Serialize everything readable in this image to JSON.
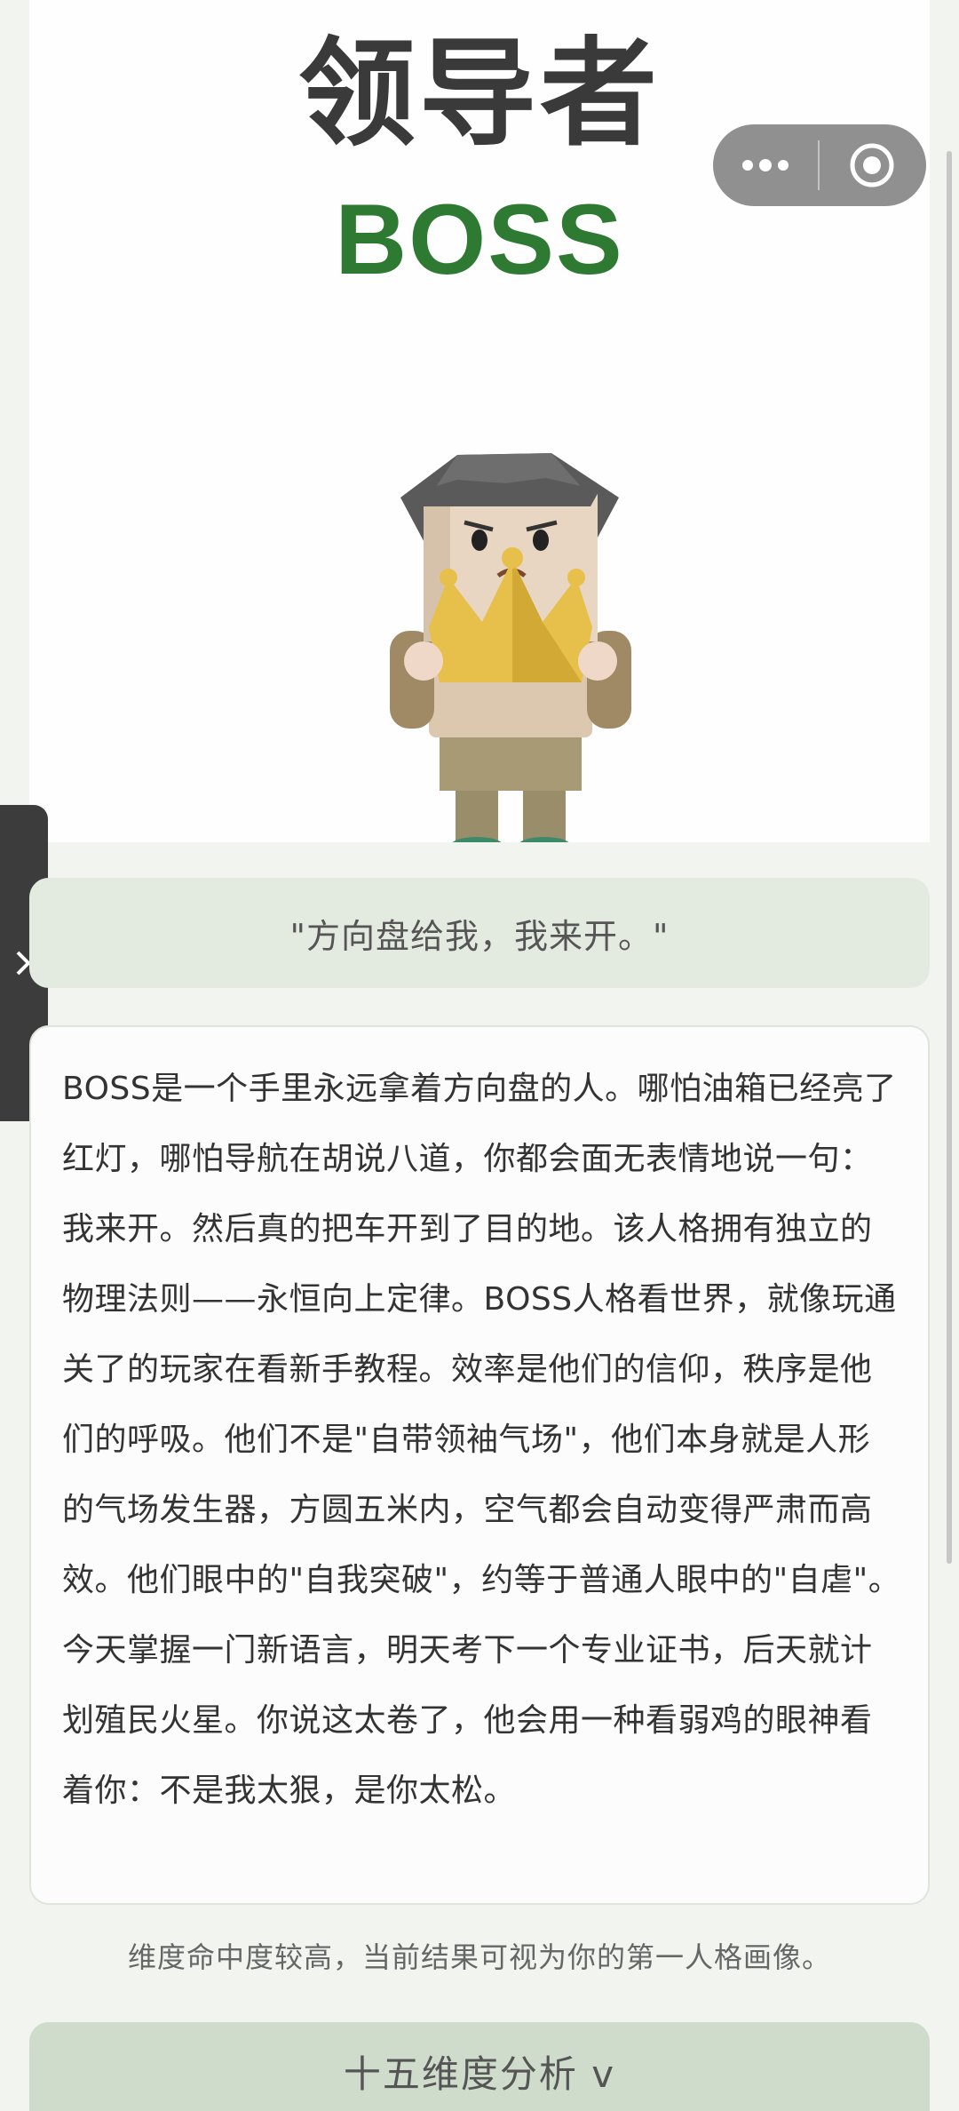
{
  "hero": {
    "title": "领导者",
    "subtitle": "BOSS"
  },
  "capsule": {
    "more_icon": "more-dots-icon",
    "close_icon": "target-close-icon"
  },
  "side_handle": {
    "icon": "chevron-right-icon"
  },
  "quote": "\"方向盘给我，我来开。\"",
  "description": "BOSS是一个手里永远拿着方向盘的人。哪怕油箱已经亮了红灯，哪怕导航在胡说八道，你都会面无表情地说一句：我来开。然后真的把车开到了目的地。该人格拥有独立的物理法则——永恒向上定律。BOSS人格看世界，就像玩通关了的玩家在看新手教程。效率是他们的信仰，秩序是他们的呼吸。他们不是\"自带领袖气场\"，他们本身就是人形的气场发生器，方圆五米内，空气都会自动变得严肃而高效。他们眼中的\"自我突破\"，约等于普通人眼中的\"自虐\"。今天掌握一门新语言，明天考下一个专业证书，后天就计划殖民火星。你说这太卷了，他会用一种看弱鸡的眼神看着你：不是我太狠，是你太松。",
  "hint": "维度命中度较高，当前结果可视为你的第一人格画像。",
  "analysis_button": "十五维度分析 v",
  "colors": {
    "accent_green": "#2f7a33",
    "quote_bg": "#e3ebe1",
    "button_bg": "#cfdccc"
  }
}
